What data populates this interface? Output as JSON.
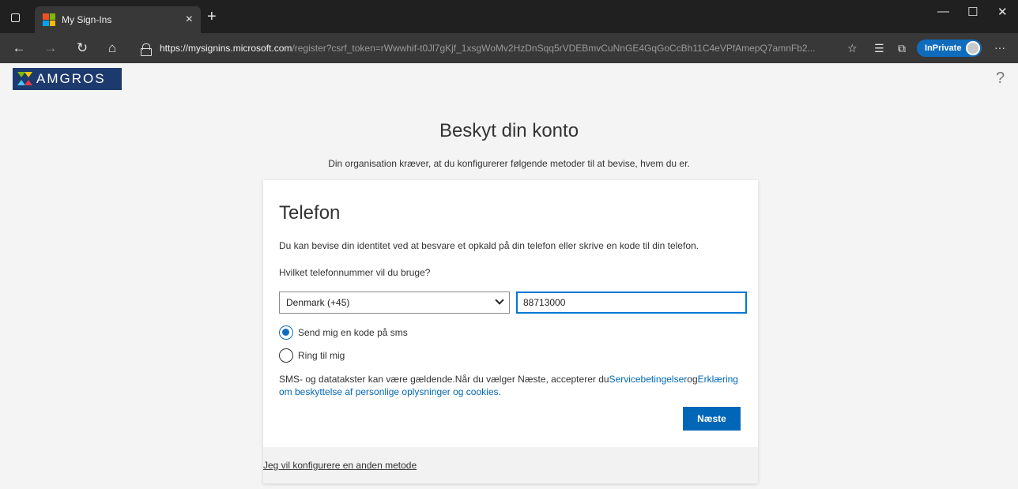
{
  "browser": {
    "tab_title": "My Sign-Ins",
    "url_host": "https://mysignins.microsoft.com",
    "url_path": "/register?csrf_token=rWwwhif-t0Jl7gKjf_1xsgWoMv2HzDnSqq5rVDEBmvCuNnGE4GqGoCcBh11C4eVPfAmepQ7amnFb2...",
    "inprivate_label": "InPrivate",
    "colors": {
      "titlebar": "#202020",
      "toolbar": "#383838",
      "inprivate": "#0f6cbd"
    }
  },
  "page": {
    "logo_text": "AMGROS",
    "help_symbol": "?",
    "heading": "Beskyt din konto",
    "subtitle": "Din organisation kræver, at du konfigurerer følgende metoder til at bevise, hvem du er."
  },
  "card": {
    "title": "Telefon",
    "description": "Du kan bevise din identitet ved at besvare et opkald på din telefon eller skrive en kode til din telefon.",
    "question": "Hvilket telefonnummer vil du bruge?",
    "country_select": "Denmark (+45)",
    "phone_value": "88713000",
    "options": [
      {
        "label": "Send mig en kode på sms",
        "selected": true
      },
      {
        "label": "Ring til mig",
        "selected": false
      }
    ],
    "terms_text": "SMS- og datatakster kan være gældende.Når du vælger Næste, accepterer du",
    "terms_link1": "Servicebetingelser",
    "terms_og": "og",
    "terms_link2": "Erklæring om beskyttelse af personlige oplysninger og cookies.",
    "next_button": "Næste",
    "footer_link": "Jeg vil konfigurere en anden metode",
    "colors": {
      "primary": "#0067b8",
      "focus": "#0078d4"
    }
  }
}
